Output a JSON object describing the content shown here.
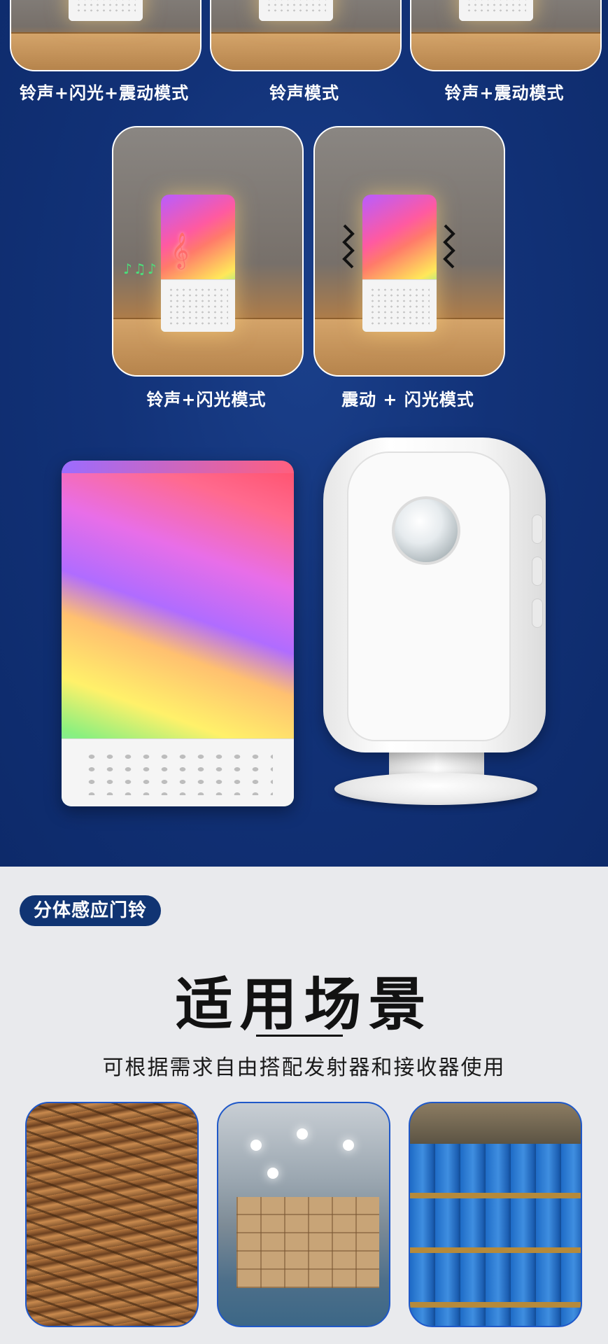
{
  "modes_row1": [
    {
      "label": "铃声+闪光+震动模式"
    },
    {
      "label": "铃声模式"
    },
    {
      "label": "铃声+震动模式"
    }
  ],
  "modes_row2": [
    {
      "label": "铃声+闪光模式",
      "note_icon": "𝄞",
      "notes": "♪♫♪"
    },
    {
      "label": "震动 + 闪光模式"
    }
  ],
  "section": {
    "badge": "分体感应门铃",
    "title": "适用场景",
    "subtitle": "可根据需求自由搭配发射器和接收器使用"
  },
  "scenes": [
    {
      "name": "steel-rebar-yard"
    },
    {
      "name": "cardboard-box-warehouse"
    },
    {
      "name": "blue-drum-warehouse"
    }
  ],
  "colors": {
    "navy": "#123278",
    "badge": "#103473",
    "card_border": "#1f58c8"
  }
}
